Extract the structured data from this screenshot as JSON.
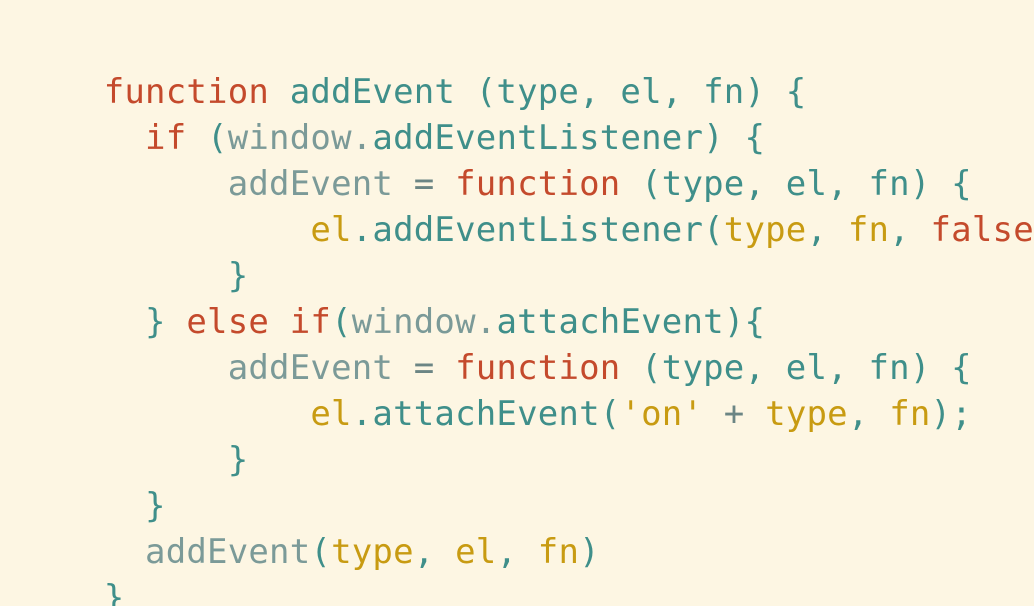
{
  "code": {
    "lines": [
      {
        "tokens": [
          {
            "text": "function",
            "type": "kw"
          },
          {
            "text": " ",
            "type": "plain"
          },
          {
            "text": "addEvent",
            "type": "fn"
          },
          {
            "text": " (type, el, fn) {",
            "type": "punc"
          }
        ]
      },
      {
        "tokens": [
          {
            "text": "  ",
            "type": "plain"
          },
          {
            "text": "if",
            "type": "kw"
          },
          {
            "text": " (",
            "type": "punc"
          },
          {
            "text": "window.",
            "type": "muted"
          },
          {
            "text": "addEventListener",
            "type": "fn"
          },
          {
            "text": ") {",
            "type": "punc"
          }
        ]
      },
      {
        "tokens": [
          {
            "text": "      ",
            "type": "plain"
          },
          {
            "text": "addEvent",
            "type": "muted"
          },
          {
            "text": " = ",
            "type": "plain"
          },
          {
            "text": "function",
            "type": "kw"
          },
          {
            "text": " (type, el, fn) {",
            "type": "punc"
          }
        ]
      },
      {
        "tokens": [
          {
            "text": "          ",
            "type": "plain"
          },
          {
            "text": "el",
            "type": "param"
          },
          {
            "text": ".addEventListener(",
            "type": "punc"
          },
          {
            "text": "type",
            "type": "param"
          },
          {
            "text": ", ",
            "type": "punc"
          },
          {
            "text": "fn",
            "type": "param"
          },
          {
            "text": ", ",
            "type": "punc"
          },
          {
            "text": "false",
            "type": "kw"
          },
          {
            "text": ");",
            "type": "punc"
          }
        ]
      },
      {
        "tokens": [
          {
            "text": "      ",
            "type": "plain"
          },
          {
            "text": "}",
            "type": "punc"
          }
        ]
      },
      {
        "tokens": [
          {
            "text": "  ",
            "type": "plain"
          },
          {
            "text": "}",
            "type": "punc"
          },
          {
            "text": " ",
            "type": "plain"
          },
          {
            "text": "else",
            "type": "kw"
          },
          {
            "text": " ",
            "type": "plain"
          },
          {
            "text": "if",
            "type": "kw"
          },
          {
            "text": "(",
            "type": "punc"
          },
          {
            "text": "window.",
            "type": "muted"
          },
          {
            "text": "attachEvent",
            "type": "fn"
          },
          {
            "text": "){",
            "type": "punc"
          }
        ]
      },
      {
        "tokens": [
          {
            "text": "      ",
            "type": "plain"
          },
          {
            "text": "addEvent",
            "type": "muted"
          },
          {
            "text": " = ",
            "type": "plain"
          },
          {
            "text": "function",
            "type": "kw"
          },
          {
            "text": " (type, el, fn) {",
            "type": "punc"
          }
        ]
      },
      {
        "tokens": [
          {
            "text": "          ",
            "type": "plain"
          },
          {
            "text": "el",
            "type": "param"
          },
          {
            "text": ".attachEvent(",
            "type": "punc"
          },
          {
            "text": "'on'",
            "type": "param"
          },
          {
            "text": " + ",
            "type": "plain"
          },
          {
            "text": "type",
            "type": "param"
          },
          {
            "text": ", ",
            "type": "punc"
          },
          {
            "text": "fn",
            "type": "param"
          },
          {
            "text": ");",
            "type": "punc"
          }
        ]
      },
      {
        "tokens": [
          {
            "text": "      ",
            "type": "plain"
          },
          {
            "text": "}",
            "type": "punc"
          }
        ]
      },
      {
        "tokens": [
          {
            "text": "  ",
            "type": "plain"
          },
          {
            "text": "}",
            "type": "punc"
          }
        ]
      },
      {
        "tokens": [
          {
            "text": "  ",
            "type": "plain"
          },
          {
            "text": "addEvent",
            "type": "muted"
          },
          {
            "text": "(",
            "type": "punc"
          },
          {
            "text": "type",
            "type": "param"
          },
          {
            "text": ", ",
            "type": "punc"
          },
          {
            "text": "el",
            "type": "param"
          },
          {
            "text": ", ",
            "type": "punc"
          },
          {
            "text": "fn",
            "type": "param"
          },
          {
            "text": ")",
            "type": "punc"
          }
        ]
      },
      {
        "tokens": [
          {
            "text": "}",
            "type": "punc"
          }
        ]
      }
    ]
  },
  "colors": {
    "background": "#fdf6e3",
    "keyword": "#c44a2c",
    "function_name": "#3f8f8a",
    "muted_identifier": "#7b9a98",
    "parameter": "#c89b12",
    "punctuation": "#3f8f8a"
  }
}
